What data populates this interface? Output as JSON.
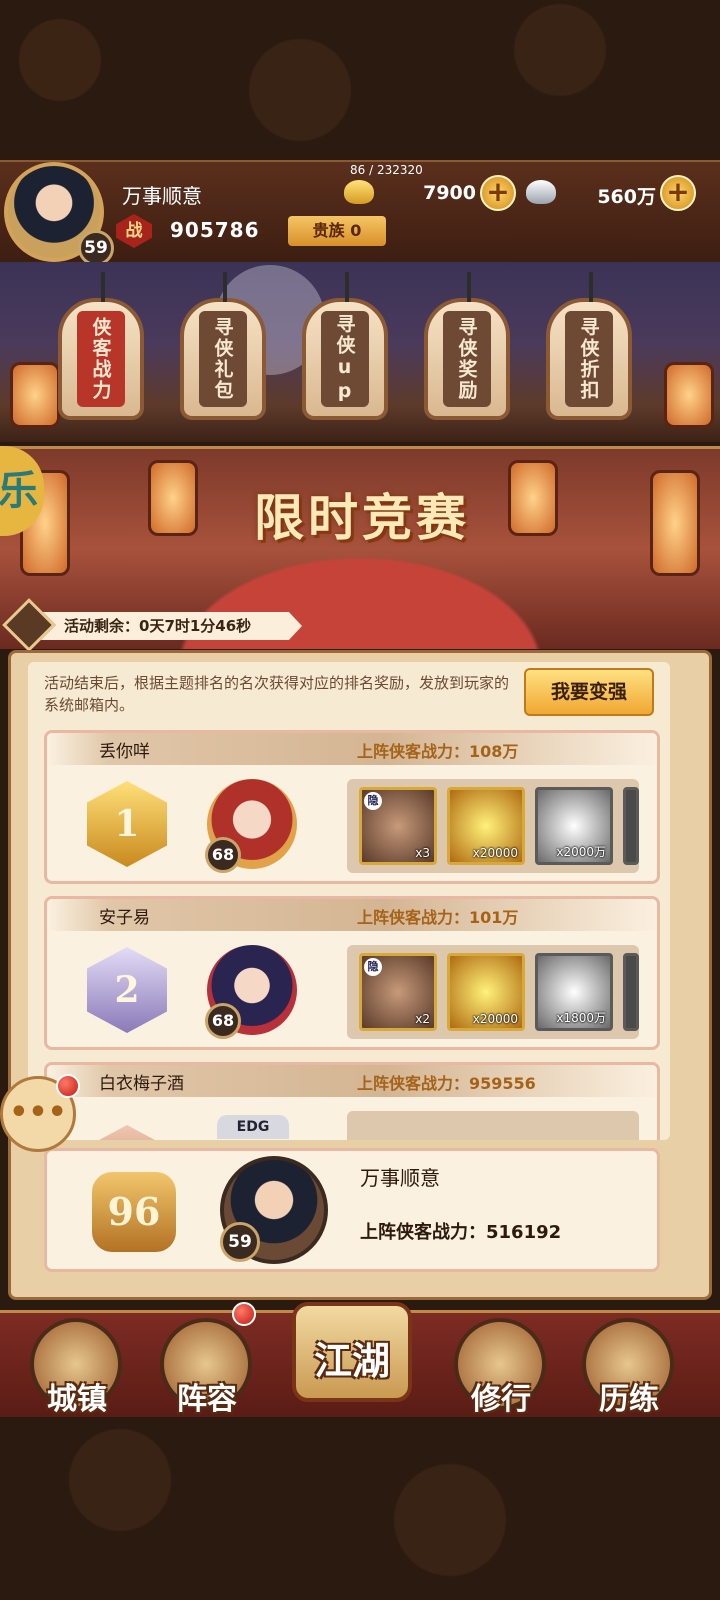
{
  "header": {
    "player_name": "万事顺意",
    "player_level": "59",
    "exp": "86 / 232320",
    "gold": "7900",
    "silver": "560万",
    "power_icon": "战",
    "power": "905786",
    "noble": "贵族 0"
  },
  "tabs": [
    {
      "label": "侠客战力",
      "active": true
    },
    {
      "label": "寻侠礼包",
      "active": false
    },
    {
      "label": "寻侠up",
      "active": false
    },
    {
      "label": "寻侠奖励",
      "active": false
    },
    {
      "label": "寻侠折扣",
      "active": false
    }
  ],
  "banner": {
    "title": "限时竞赛",
    "timer": "活动剩余：0天7时1分46秒"
  },
  "panel": {
    "description": "活动结束后，根据主题排名的名次获得对应的排名奖励，发放到玩家的系统邮箱内。",
    "strong_button": "我要变强"
  },
  "ranking": [
    {
      "rank": "1",
      "name": "丢你咩",
      "power": "上阵侠客战力：108万",
      "hero_level": "68",
      "rewards": [
        {
          "tag": "隐",
          "count": "x3"
        },
        {
          "count": "x20000"
        },
        {
          "count": "x2000万"
        }
      ]
    },
    {
      "rank": "2",
      "name": "安子易",
      "power": "上阵侠客战力：101万",
      "hero_level": "68",
      "rewards": [
        {
          "tag": "隐",
          "count": "x2"
        },
        {
          "count": "x20000"
        },
        {
          "count": "x1800万"
        }
      ]
    },
    {
      "name": "白衣梅子酒",
      "power": "上阵侠客战力：959556",
      "hero_badge": "EDG"
    }
  ],
  "me": {
    "rank": "96",
    "name": "万事顺意",
    "level": "59",
    "power": "上阵侠客战力：516192"
  },
  "nav": [
    {
      "label": "城镇",
      "icon": "town-icon"
    },
    {
      "label": "阵容",
      "icon": "lineup-icon"
    },
    {
      "label": "江湖",
      "icon": "jianghu-scroll-icon"
    },
    {
      "label": "修行",
      "icon": "cultivation-icon"
    },
    {
      "label": "历练",
      "icon": "training-icon"
    }
  ],
  "colors": {
    "accent_gold": "#f0a832",
    "active_tab": "#b8352a",
    "power_text": "#a56318"
  }
}
